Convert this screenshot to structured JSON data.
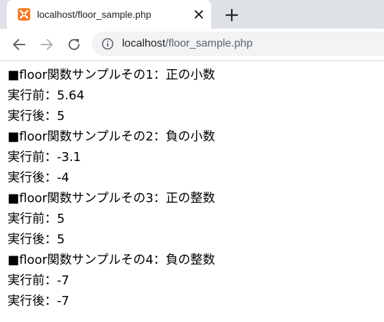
{
  "tab": {
    "title": "localhost/floor_sample.php"
  },
  "address_bar": {
    "host": "localhost",
    "path": "/floor_sample.php"
  },
  "colors": {
    "favicon": "#fb7a24",
    "tabstrip": "#dee1e6",
    "omnibox": "#f1f3f4"
  },
  "icons": {
    "favicon": "xampp-icon",
    "close": "close-icon",
    "new_tab": "plus-icon",
    "back": "back-arrow-icon",
    "forward": "forward-arrow-icon",
    "reload": "reload-icon",
    "site_info": "info-icon"
  },
  "content": {
    "lines": [
      "■floor関数サンプルその1：正の小数",
      "実行前：5.64",
      "実行後：5",
      "■floor関数サンプルその2：負の小数",
      "実行前：-3.1",
      "実行後：-4",
      "■floor関数サンプルその3：正の整数",
      "実行前：5",
      "実行後：5",
      "■floor関数サンプルその4：負の整数",
      "実行前：-7",
      "実行後：-7"
    ]
  }
}
